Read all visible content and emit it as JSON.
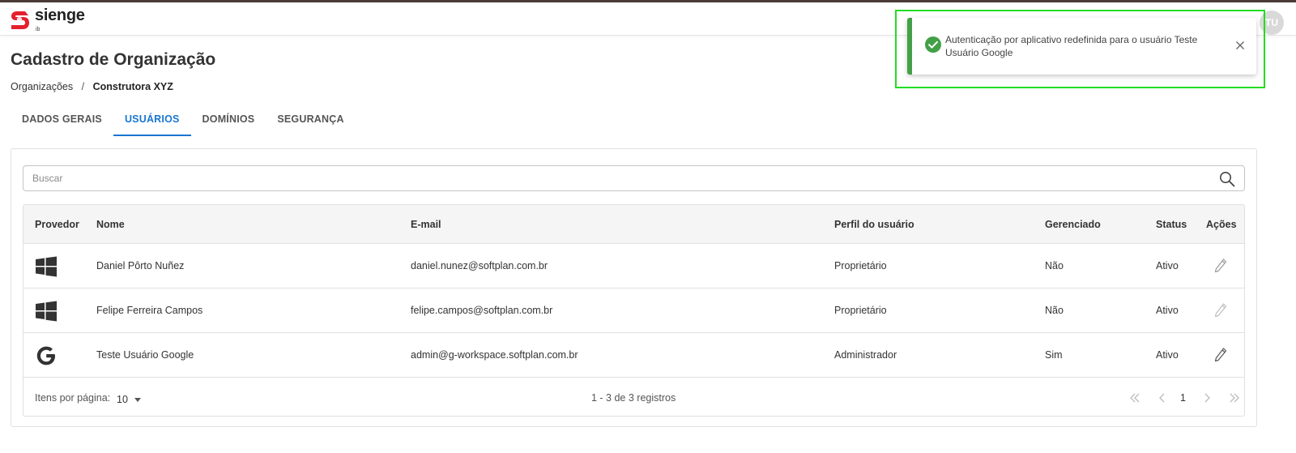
{
  "app": {
    "logo_text": "sienge",
    "logo_sub": "ib",
    "avatar_initials": "TU",
    "brand_color": "#e4202e",
    "accent_color": "#1976d2"
  },
  "page": {
    "title": "Cadastro de Organização",
    "breadcrumb": {
      "parent": "Organizações",
      "separator": "/",
      "current": "Construtora XYZ"
    }
  },
  "tabs": [
    {
      "label": "DADOS GERAIS",
      "active": false
    },
    {
      "label": "USUÁRIOS",
      "active": true
    },
    {
      "label": "DOMÍNIOS",
      "active": false
    },
    {
      "label": "SEGURANÇA",
      "active": false
    }
  ],
  "search": {
    "placeholder": "Buscar",
    "value": "",
    "icon": "search-icon"
  },
  "table": {
    "columns": [
      "Provedor",
      "Nome",
      "E-mail",
      "Perfil do usuário",
      "Gerenciado",
      "Status",
      "Ações"
    ],
    "rows": [
      {
        "provider": "windows-icon",
        "name": "Daniel Pôrto Nuñez",
        "email": "daniel.nunez@softplan.com.br",
        "profile": "Proprietário",
        "managed": "Não",
        "status": "Ativo"
      },
      {
        "provider": "windows-icon",
        "name": "Felipe Ferreira Campos",
        "email": "felipe.campos@softplan.com.br",
        "profile": "Proprietário",
        "managed": "Não",
        "status": "Ativo"
      },
      {
        "provider": "google-icon",
        "name": "Teste Usuário Google",
        "email": "admin@g-workspace.softplan.com.br",
        "profile": "Administrador",
        "managed": "Sim",
        "status": "Ativo"
      }
    ]
  },
  "pagination": {
    "items_per_page_label": "Itens por página:",
    "items_per_page": "10",
    "range_text": "1 - 3 de 3 registros",
    "current_page": "1"
  },
  "toast": {
    "message": "Autenticação por aplicativo redefinida para o usuário Teste Usuário Google",
    "type": "success",
    "color": "#43a047"
  }
}
